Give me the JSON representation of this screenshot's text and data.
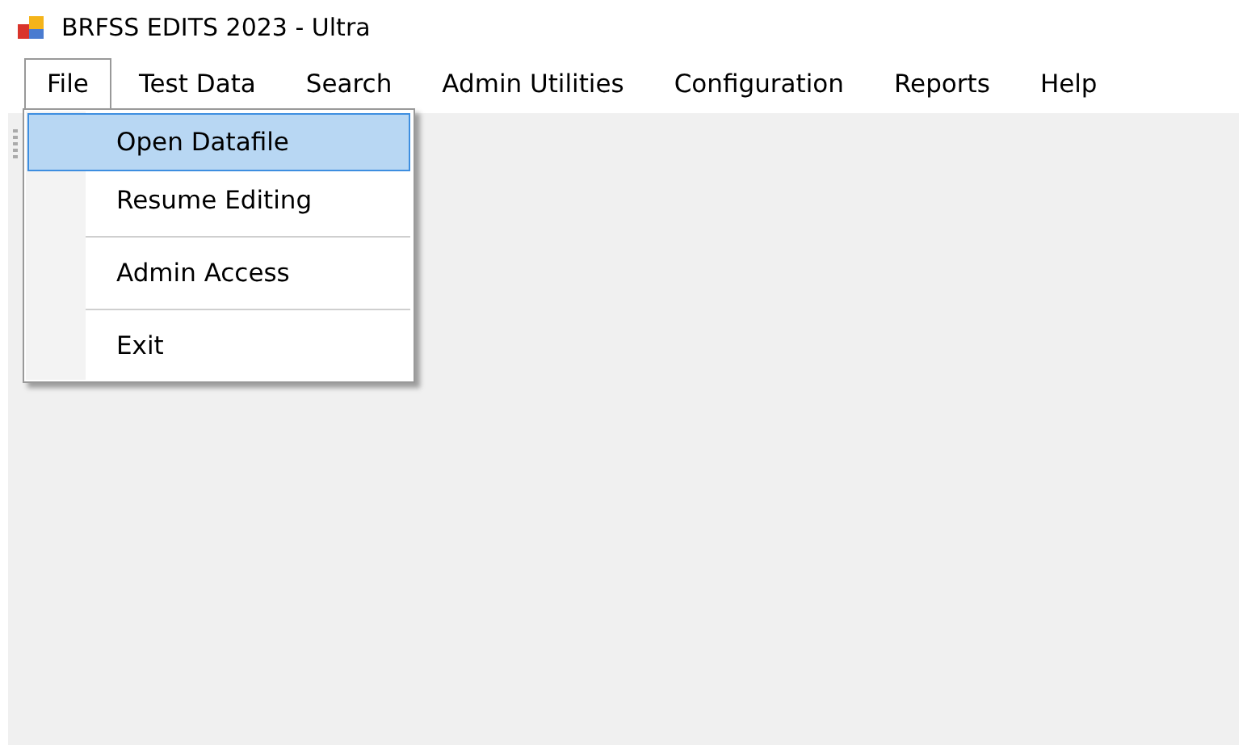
{
  "window": {
    "title": "BRFSS EDITS 2023 - Ultra"
  },
  "menu_bar": [
    {
      "label": "File",
      "expanded": true
    },
    {
      "label": "Test Data",
      "expanded": false
    },
    {
      "label": "Search",
      "expanded": false
    },
    {
      "label": "Admin Utilities",
      "expanded": false
    },
    {
      "label": "Configuration",
      "expanded": false
    },
    {
      "label": "Reports",
      "expanded": false
    },
    {
      "label": "Help",
      "expanded": false
    }
  ],
  "file_menu": [
    {
      "kind": "item",
      "label": "Open Datafile",
      "selected": true
    },
    {
      "kind": "item",
      "label": "Resume Editing",
      "selected": false
    },
    {
      "kind": "separator"
    },
    {
      "kind": "item",
      "label": "Admin Access",
      "selected": false
    },
    {
      "kind": "separator"
    },
    {
      "kind": "item",
      "label": "Exit",
      "selected": false
    }
  ]
}
